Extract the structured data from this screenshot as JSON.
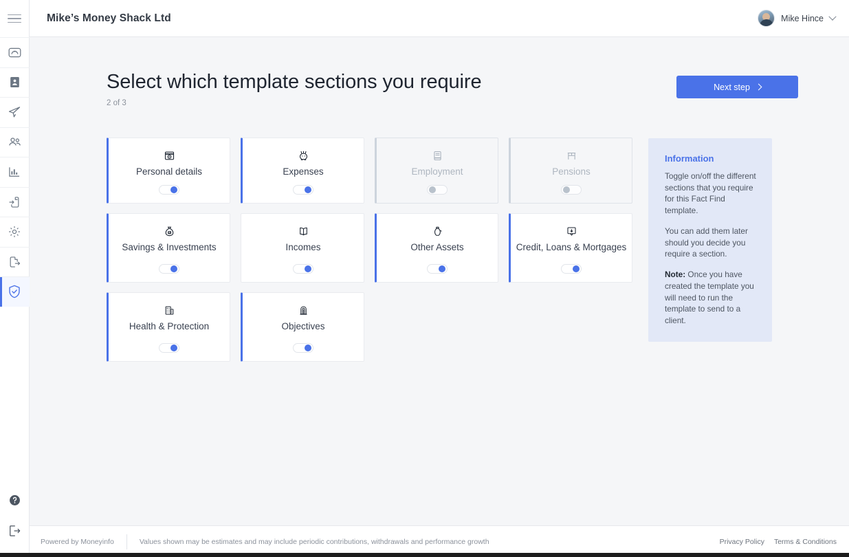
{
  "header": {
    "org_title": "Mike’s Money Shack Ltd",
    "user_name": "Mike Hince",
    "menu_icon": "hamburger-icon",
    "chevron_icon": "chevron-down-icon"
  },
  "sidebar": {
    "items": [
      {
        "icon": "dashboard-gauge-icon",
        "active": false
      },
      {
        "icon": "contact-card-icon",
        "active": false
      },
      {
        "icon": "paper-plane-icon",
        "active": false
      },
      {
        "icon": "people-group-icon",
        "active": false
      },
      {
        "icon": "bar-chart-icon",
        "active": false
      },
      {
        "icon": "file-import-icon",
        "active": false
      },
      {
        "icon": "gear-settings-icon",
        "active": false
      },
      {
        "icon": "file-export-icon",
        "active": false
      },
      {
        "icon": "shield-check-icon",
        "active": true
      }
    ],
    "bottom_items": [
      {
        "icon": "help-circle-icon"
      },
      {
        "icon": "logout-icon"
      }
    ]
  },
  "page": {
    "title": "Select which template sections you require",
    "step": "2 of 3",
    "next_button": "Next step",
    "next_button_icon": "chevron-right-icon"
  },
  "cards": {
    "rows": [
      [
        {
          "label": "Personal details",
          "icon": "id-badge-icon",
          "enabled": true,
          "accent": true,
          "toggle_on": true
        },
        {
          "label": "Expenses",
          "icon": "piggy-bank-icon",
          "enabled": true,
          "accent": true,
          "toggle_on": true
        },
        {
          "label": "Employment",
          "icon": "briefcase-document-icon",
          "enabled": false,
          "accent": false,
          "toggle_on": false
        },
        {
          "label": "Pensions",
          "icon": "bank-pillar-icon",
          "enabled": false,
          "accent": false,
          "toggle_on": false
        }
      ],
      [
        {
          "label": "Savings & Investments",
          "icon": "money-bag-icon",
          "enabled": true,
          "accent": true,
          "toggle_on": true
        },
        {
          "label": "Incomes",
          "icon": "open-book-icon",
          "enabled": true,
          "accent": false,
          "toggle_on": true
        },
        {
          "label": "Other Assets",
          "icon": "vase-asset-icon",
          "enabled": true,
          "accent": true,
          "toggle_on": true
        },
        {
          "label": "Credit, Loans & Mortgages",
          "icon": "card-arrow-icon",
          "enabled": true,
          "accent": true,
          "toggle_on": true
        }
      ],
      [
        {
          "label": "Health & Protection",
          "icon": "hospital-building-icon",
          "enabled": true,
          "accent": true,
          "toggle_on": true
        },
        {
          "label": "Objectives",
          "icon": "monument-icon",
          "enabled": true,
          "accent": true,
          "toggle_on": true
        }
      ]
    ]
  },
  "info_panel": {
    "title": "Information",
    "paragraph1": "Toggle on/off the different sections that you require for this Fact Find template.",
    "paragraph2": "You can add them later should you decide you require a section.",
    "note_label": "Note:",
    "note_text": " Once you have created the template you will need to run the template to send to a client."
  },
  "footer": {
    "powered_by": "Powered by Moneyinfo",
    "disclaimer": "Values shown may be estimates and may include periodic contributions, withdrawals and performance growth",
    "privacy_policy": "Privacy Policy",
    "terms": "Terms & Conditions"
  },
  "colors": {
    "accent_blue": "#4a72e8",
    "page_bg": "#f5f6f8",
    "info_bg": "#e2e8f7",
    "toggle_off": "#b9c2cc"
  }
}
